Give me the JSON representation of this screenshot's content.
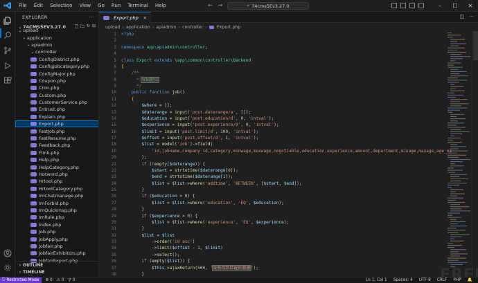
{
  "titlebar": {
    "menu": [
      "File",
      "Edit",
      "Selection",
      "View",
      "Go",
      "Run",
      "Terminal",
      "Help"
    ],
    "search": "74cms5Ev3.27.0"
  },
  "sidebar": {
    "header": "EXPLORER",
    "root": "74CMS5EV3.27.0",
    "folders": [
      {
        "label": "upload",
        "depth": 1
      },
      {
        "label": "application",
        "depth": 2
      },
      {
        "label": "apiadmin",
        "depth": 3
      },
      {
        "label": "controller",
        "depth": 4
      }
    ],
    "files": [
      "ConfigDistrict.php",
      "ConfigJobcategory.php",
      "ConfigMajor.php",
      "Coupon.php",
      "Cron.php",
      "Custom.php",
      "CustomerService.php",
      "Entrust.php",
      "Explain.php",
      "Export.php",
      "FastJob.php",
      "FastResume.php",
      "Feedback.php",
      "Flink.php",
      "Help.php",
      "HelpCategory.php",
      "Hotword.php",
      "Hrtool.php",
      "HrtoolCategory.php",
      "ImChatmanage.php",
      "ImForbid.php",
      "ImQuickmsg.php",
      "ImRule.php",
      "Index.php",
      "Job.php",
      "JobApply.php",
      "Jobfair.php",
      "JobfairExhibitors.php",
      "JobfairExport.php"
    ],
    "selected_file": "Export.php",
    "outline_label": "OUTLINE",
    "timeline_label": "TIMELINE"
  },
  "tab": {
    "label": "Export.php"
  },
  "breadcrumb": [
    "upload",
    "application",
    "apiadmin",
    "controller",
    "Export.php"
  ],
  "code": {
    "line_numbers": [
      "1",
      "2",
      "3",
      "4",
      "5",
      "6",
      "7",
      "8",
      "9",
      "10",
      "11",
      "12",
      "13",
      "14",
      "15",
      "16",
      "17",
      "18",
      "19",
      "20",
      "21",
      "22",
      "23",
      "24",
      "25",
      "26",
      "27",
      "28",
      "29",
      "30",
      "31",
      "32",
      "33",
      "34",
      "35",
      "36",
      "37",
      "38"
    ],
    "comment_text": "导出职位",
    "ajax_message": "没有找到匹配的数据"
  },
  "statusbar": {
    "restricted": "Restricted Mode",
    "errors": "0",
    "warnings": "0",
    "ports": "0",
    "position": "Ln 1, Col 1",
    "spaces": "Spaces: 4",
    "encoding": "UTF-8",
    "eol": "CRLF",
    "language": "PHP"
  },
  "watermark": "FREEBUF",
  "colors": {
    "accent": "#0078d4",
    "restricted": "#6c3ad0",
    "php_icon": "#8a7ad8"
  }
}
